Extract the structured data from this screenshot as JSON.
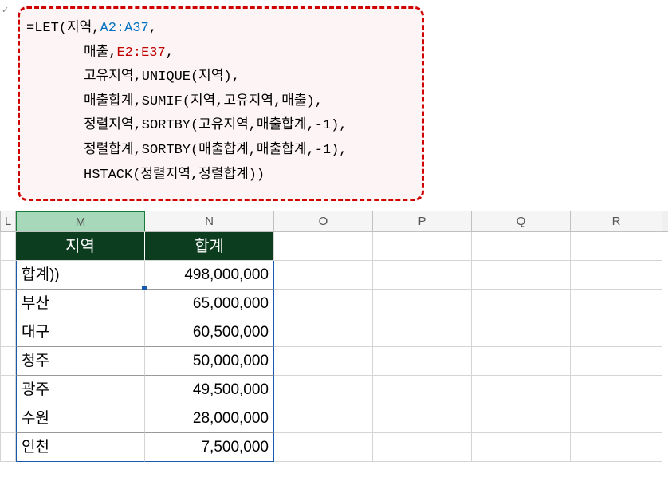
{
  "formula": {
    "line1_prefix": "=LET(지역,",
    "line1_ref": "A2:A37",
    "line1_suffix": ",",
    "line2_prefix": "매출,",
    "line2_ref": "E2:E37",
    "line2_suffix": ",",
    "line3": "고유지역,UNIQUE(지역),",
    "line4": "매출합계,SUMIF(지역,고유지역,매출),",
    "line5": "정렬지역,SORTBY(고유지역,매출합계,-1),",
    "line6": "정렬합계,SORTBY(매출합계,매출합계,-1),",
    "line7": "HSTACK(정렬지역,정렬합계))"
  },
  "columns": {
    "L": "L",
    "M": "M",
    "N": "N",
    "O": "O",
    "P": "P",
    "Q": "Q",
    "R": "R"
  },
  "table": {
    "header_region": "지역",
    "header_total": "합계",
    "rows": [
      {
        "region": "합계))",
        "total": "498,000,000"
      },
      {
        "region": "부산",
        "total": "65,000,000"
      },
      {
        "region": "대구",
        "total": "60,500,000"
      },
      {
        "region": "청주",
        "total": "50,000,000"
      },
      {
        "region": "광주",
        "total": "49,500,000"
      },
      {
        "region": "수원",
        "total": "28,000,000"
      },
      {
        "region": "인천",
        "total": "7,500,000"
      }
    ]
  }
}
